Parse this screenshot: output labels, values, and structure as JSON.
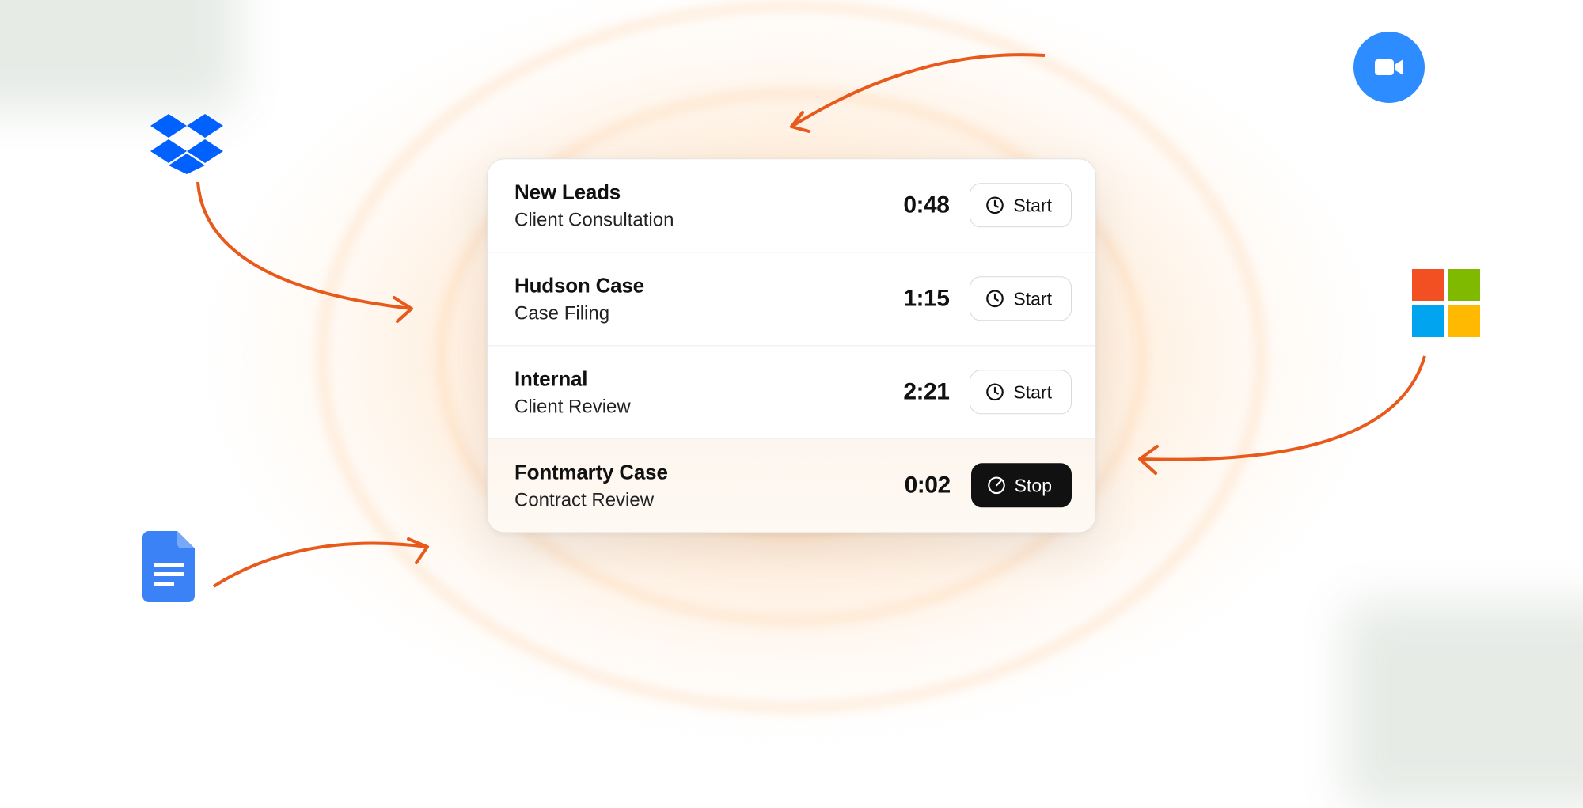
{
  "entries": [
    {
      "title": "New Leads",
      "subtitle": "Client Consultation",
      "time": "0:48",
      "button_label": "Start",
      "running": false
    },
    {
      "title": "Hudson Case",
      "subtitle": "Case Filing",
      "time": "1:15",
      "button_label": "Start",
      "running": false
    },
    {
      "title": "Internal",
      "subtitle": "Client Review",
      "time": "2:21",
      "button_label": "Start",
      "running": false
    },
    {
      "title": "Fontmarty Case",
      "subtitle": "Contract Review",
      "time": "0:02",
      "button_label": "Stop",
      "running": true
    }
  ],
  "integrations": {
    "zoom": "zoom",
    "dropbox": "dropbox",
    "google_docs": "google-docs",
    "microsoft": "microsoft"
  },
  "colors": {
    "accent_orange": "#e8591c",
    "zoom_blue": "#2d8cff",
    "dropbox_blue": "#0061ff",
    "docs_blue": "#3b82f6",
    "ms_red": "#f25022",
    "ms_green": "#7fba00",
    "ms_blue": "#00a4ef",
    "ms_yellow": "#ffb900",
    "stop_bg": "#111111"
  }
}
